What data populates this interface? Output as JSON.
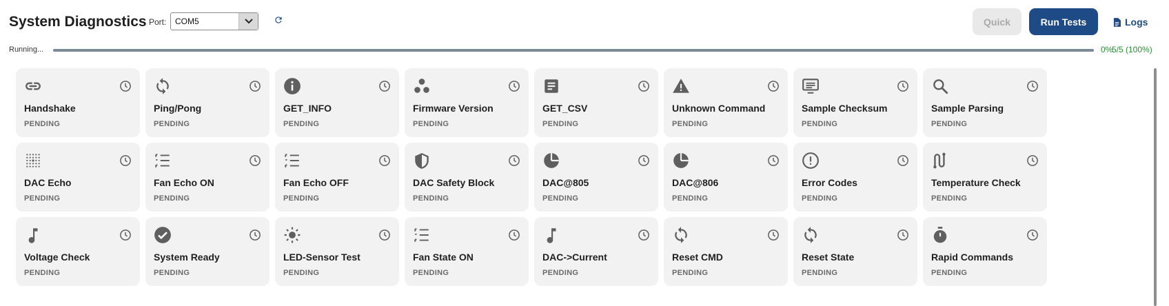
{
  "header": {
    "title": "System Diagnostics",
    "port_label": "Port:",
    "port_value": "COM5",
    "quick_label": "Quick",
    "run_label": "Run Tests",
    "logs_label": "Logs"
  },
  "progress": {
    "status_text": "Running...",
    "percent_text": "0%",
    "count_text": "5/5 (100%)",
    "fill_fraction": 1.0
  },
  "colors": {
    "run_button": "#1e4a86",
    "progress_text": "#2e8b3a",
    "card_bg": "#f2f2f2"
  },
  "tests": [
    {
      "name": "Handshake",
      "status": "PENDING",
      "icon": "link-icon"
    },
    {
      "name": "Ping/Pong",
      "status": "PENDING",
      "icon": "sync-icon"
    },
    {
      "name": "GET_INFO",
      "status": "PENDING",
      "icon": "info-icon"
    },
    {
      "name": "Firmware Version",
      "status": "PENDING",
      "icon": "cluster-icon"
    },
    {
      "name": "GET_CSV",
      "status": "PENDING",
      "icon": "document-icon"
    },
    {
      "name": "Unknown Command",
      "status": "PENDING",
      "icon": "warning-icon"
    },
    {
      "name": "Sample Checksum",
      "status": "PENDING",
      "icon": "monitor-icon"
    },
    {
      "name": "Sample Parsing",
      "status": "PENDING",
      "icon": "search-icon"
    },
    {
      "name": "DAC Echo",
      "status": "PENDING",
      "icon": "dots-grid-icon"
    },
    {
      "name": "Fan Echo ON",
      "status": "PENDING",
      "icon": "list-icon"
    },
    {
      "name": "Fan Echo OFF",
      "status": "PENDING",
      "icon": "list-icon"
    },
    {
      "name": "DAC Safety Block",
      "status": "PENDING",
      "icon": "shield-icon"
    },
    {
      "name": "DAC@805",
      "status": "PENDING",
      "icon": "pie-icon"
    },
    {
      "name": "DAC@806",
      "status": "PENDING",
      "icon": "pie-icon"
    },
    {
      "name": "Error Codes",
      "status": "PENDING",
      "icon": "alert-circle-icon"
    },
    {
      "name": "Temperature Check",
      "status": "PENDING",
      "icon": "route-icon"
    },
    {
      "name": "Voltage Check",
      "status": "PENDING",
      "icon": "music-note-icon"
    },
    {
      "name": "System Ready",
      "status": "PENDING",
      "icon": "check-circle-icon"
    },
    {
      "name": "LED-Sensor Test",
      "status": "PENDING",
      "icon": "sun-icon"
    },
    {
      "name": "Fan State ON",
      "status": "PENDING",
      "icon": "list-icon"
    },
    {
      "name": "DAC->Current",
      "status": "PENDING",
      "icon": "music-note-icon"
    },
    {
      "name": "Reset CMD",
      "status": "PENDING",
      "icon": "sync-icon"
    },
    {
      "name": "Reset State",
      "status": "PENDING",
      "icon": "sync-icon"
    },
    {
      "name": "Rapid Commands",
      "status": "PENDING",
      "icon": "stopwatch-icon"
    }
  ]
}
